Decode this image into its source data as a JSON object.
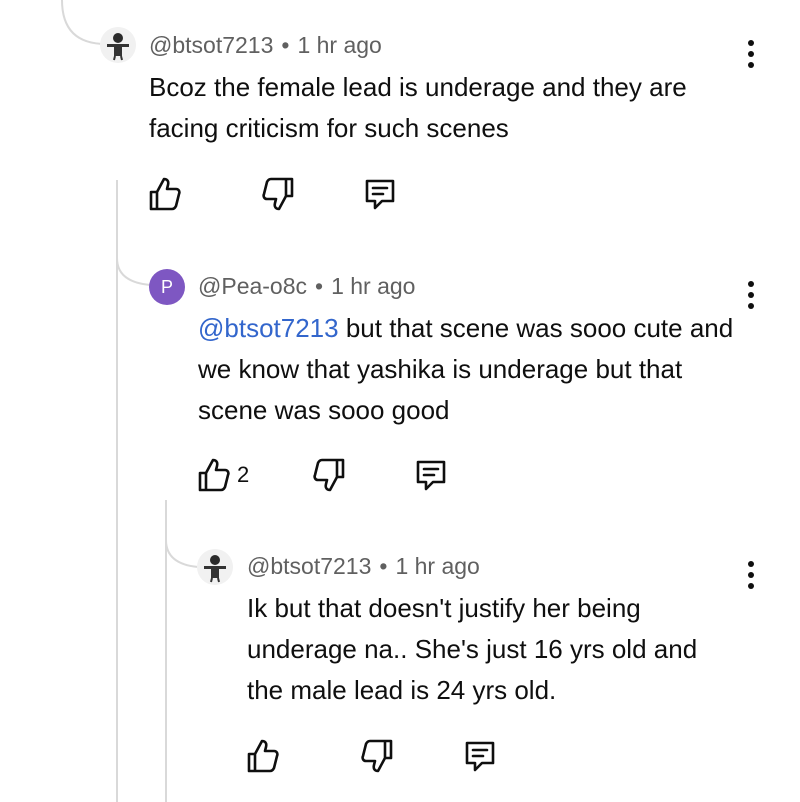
{
  "comments": [
    {
      "author": "@btsot7213",
      "time": "1 hr ago",
      "separator": "•",
      "text": "Bcoz the female lead is underage and they are facing criticism for such scenes",
      "likes": "",
      "avatar_type": "photo"
    },
    {
      "author": "@Pea-o8c",
      "time": "1 hr ago",
      "separator": "•",
      "avatar_letter": "P",
      "avatar_color": "#7e57c2",
      "mention": "@btsot7213",
      "text": " but that scene was sooo cute and we know that yashika is underage but that scene was sooo good",
      "likes": "2",
      "avatar_type": "letter"
    },
    {
      "author": "@btsot7213",
      "time": "1 hr ago",
      "separator": "•",
      "text": "Ik but that doesn't justify her being underage na.. She's just 16 yrs old and the male lead is 24 yrs old.",
      "likes": "",
      "avatar_type": "photo"
    }
  ],
  "icons": {
    "like": "thumbs-up-icon",
    "dislike": "thumbs-down-icon",
    "reply": "reply-icon",
    "more": "more-vertical-icon"
  },
  "colors": {
    "meta": "#606060",
    "mention": "#3366cc",
    "thread_line": "#d9d9d9"
  }
}
